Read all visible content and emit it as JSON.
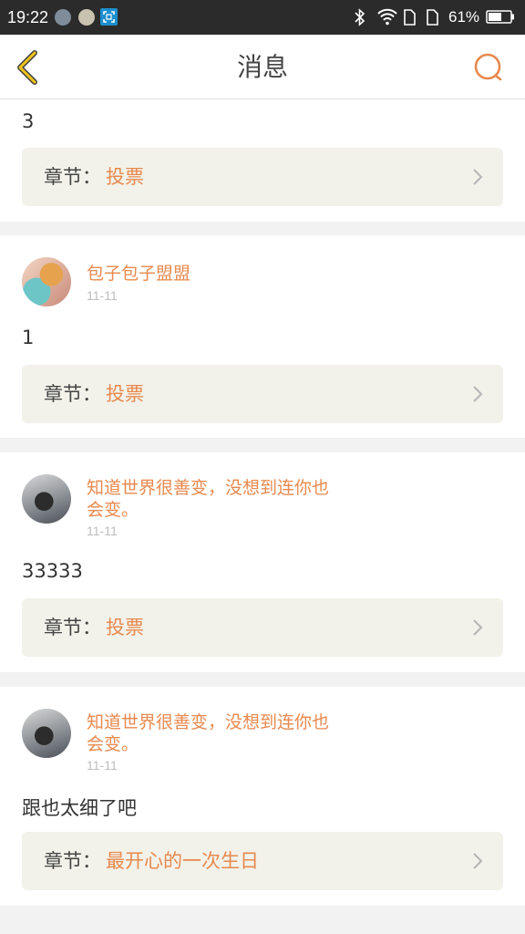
{
  "status_bar": {
    "time": "19:22",
    "battery_percent": "61%",
    "battery_level": 0.61,
    "icons": [
      "app-icon",
      "app-icon",
      "scan-icon",
      "bluetooth-icon",
      "wifi-icon",
      "sim-icon",
      "sim-icon",
      "battery-icon"
    ]
  },
  "header": {
    "title": "消息",
    "back_icon": "chevron-left-icon",
    "search_icon": "search-icon"
  },
  "colors": {
    "accent": "#e8894e",
    "back_arrow": "#f0c419",
    "chapter_bg": "#f2f2ea",
    "page_bg": "#f2f2f2"
  },
  "chapter_label": "章节：",
  "messages": [
    {
      "user": "",
      "date": "",
      "text": "3",
      "chapter": "投票"
    },
    {
      "user": "包子包子盟盟",
      "date": "11-11",
      "text": "1",
      "chapter": "投票"
    },
    {
      "user": "知道世界很善变，没想到连你也会变。",
      "date": "11-11",
      "text": "33333",
      "chapter": "投票"
    },
    {
      "user": "知道世界很善变，没想到连你也会变。",
      "date": "11-11",
      "text": "跟也太细了吧",
      "chapter": "最开心的一次生日"
    }
  ]
}
